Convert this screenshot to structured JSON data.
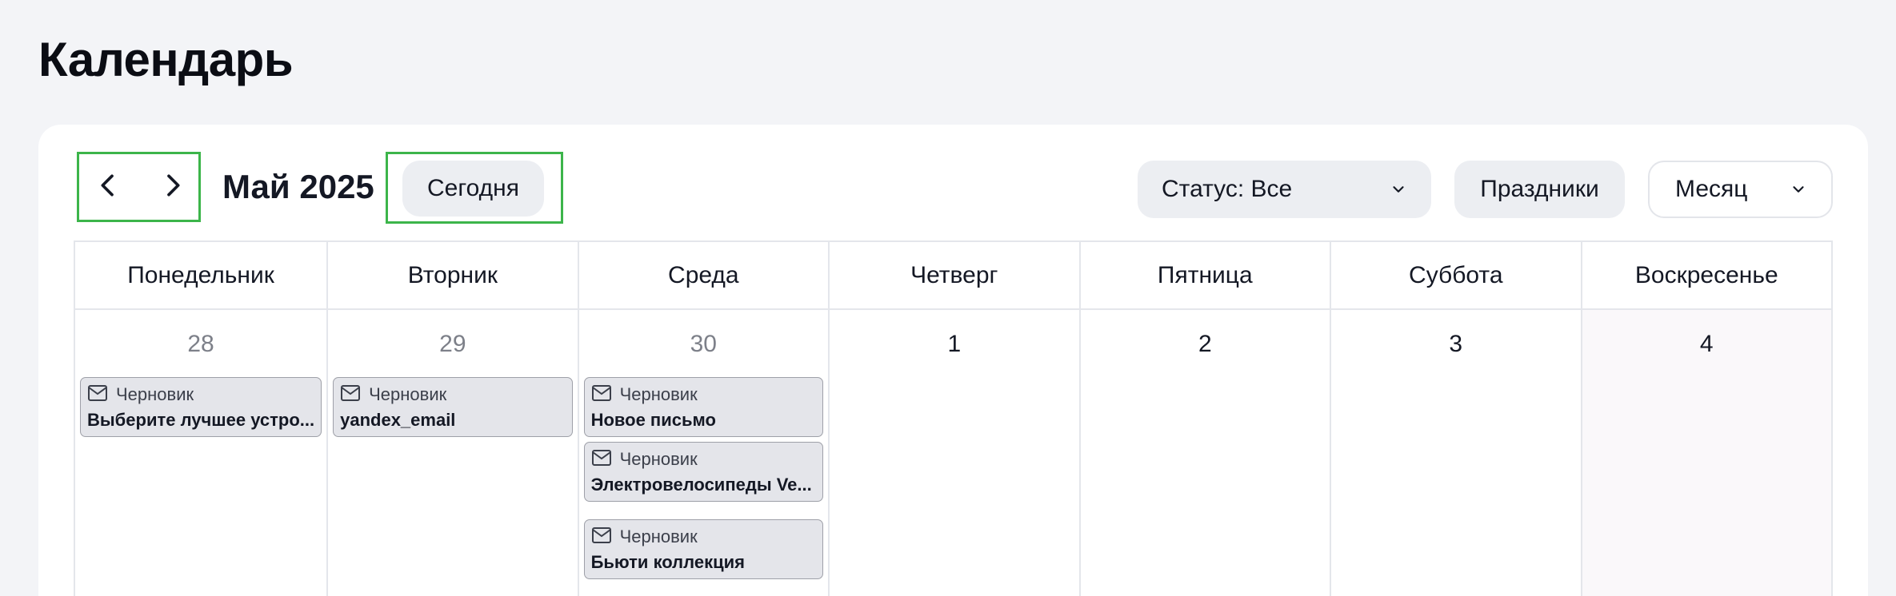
{
  "page": {
    "title": "Календарь"
  },
  "toolbar": {
    "month_label": "Май 2025",
    "today_label": "Сегодня",
    "status_filter": "Статус: Все",
    "holidays_label": "Праздники",
    "view_mode": "Месяц"
  },
  "weekdays": [
    "Понедельник",
    "Вторник",
    "Среда",
    "Четверг",
    "Пятница",
    "Суббота",
    "Воскресенье"
  ],
  "days": [
    {
      "number": "28",
      "current_month": false,
      "events": [
        {
          "status": "Черновик",
          "title": "Выберите лучшее устро..."
        }
      ]
    },
    {
      "number": "29",
      "current_month": false,
      "events": [
        {
          "status": "Черновик",
          "title": "yandex_email"
        }
      ]
    },
    {
      "number": "30",
      "current_month": false,
      "events": [
        {
          "status": "Черновик",
          "title": "Новое письмо"
        },
        {
          "status": "Черновик",
          "title": "Электровелосипеды Ve..."
        },
        {
          "status": "Черновик",
          "title": "Бьюти коллекция"
        }
      ]
    },
    {
      "number": "1",
      "current_month": true,
      "events": []
    },
    {
      "number": "2",
      "current_month": true,
      "events": []
    },
    {
      "number": "3",
      "current_month": true,
      "events": []
    },
    {
      "number": "4",
      "current_month": true,
      "events": []
    }
  ],
  "icons": {
    "prev": "chevron-left-icon",
    "next": "chevron-right-icon",
    "dropdown": "chevron-down-icon",
    "event": "envelope-icon"
  },
  "colors": {
    "highlight": "#3cb54a",
    "button_bg": "#eceef2",
    "event_bg": "#e4e5ea"
  }
}
